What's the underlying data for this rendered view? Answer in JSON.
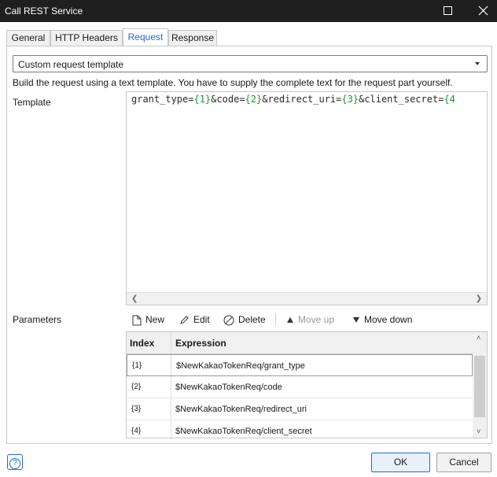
{
  "window": {
    "title": "Call REST Service"
  },
  "tabs": [
    {
      "label": "General"
    },
    {
      "label": "HTTP Headers"
    },
    {
      "label": "Request"
    },
    {
      "label": "Response"
    }
  ],
  "request": {
    "mode_value": "Custom request template",
    "hint": "Build the request using a text template. You have to supply the complete text for the request part yourself.",
    "template_label": "Template",
    "template": {
      "p1": "grant_type=",
      "ph1": "{1}",
      "p2": "&code=",
      "ph2": "{2}",
      "p3": "&redirect_uri=",
      "ph3": "{3}",
      "p4": "&client_secret=",
      "ph4": "{4"
    },
    "parameters_label": "Parameters"
  },
  "toolbar": {
    "new": "New",
    "edit": "Edit",
    "delete": "Delete",
    "move_up": "Move up",
    "move_down": "Move down"
  },
  "parameters": {
    "columns": [
      "Index",
      "Expression"
    ],
    "rows": [
      {
        "index": "{1}",
        "expression": "$NewKakaoTokenReq/grant_type"
      },
      {
        "index": "{2}",
        "expression": "$NewKakaoTokenReq/code"
      },
      {
        "index": "{3}",
        "expression": "$NewKakaoTokenReq/redirect_uri"
      },
      {
        "index": "{4}",
        "expression": "$NewKakaoTokenReq/client_secret"
      }
    ]
  },
  "footer": {
    "ok": "OK",
    "cancel": "Cancel",
    "help": "?"
  },
  "colors": {
    "accent": "#1e6ad6",
    "placeholder": "#1a9a2a",
    "titlebar": "#1f1f1f"
  }
}
